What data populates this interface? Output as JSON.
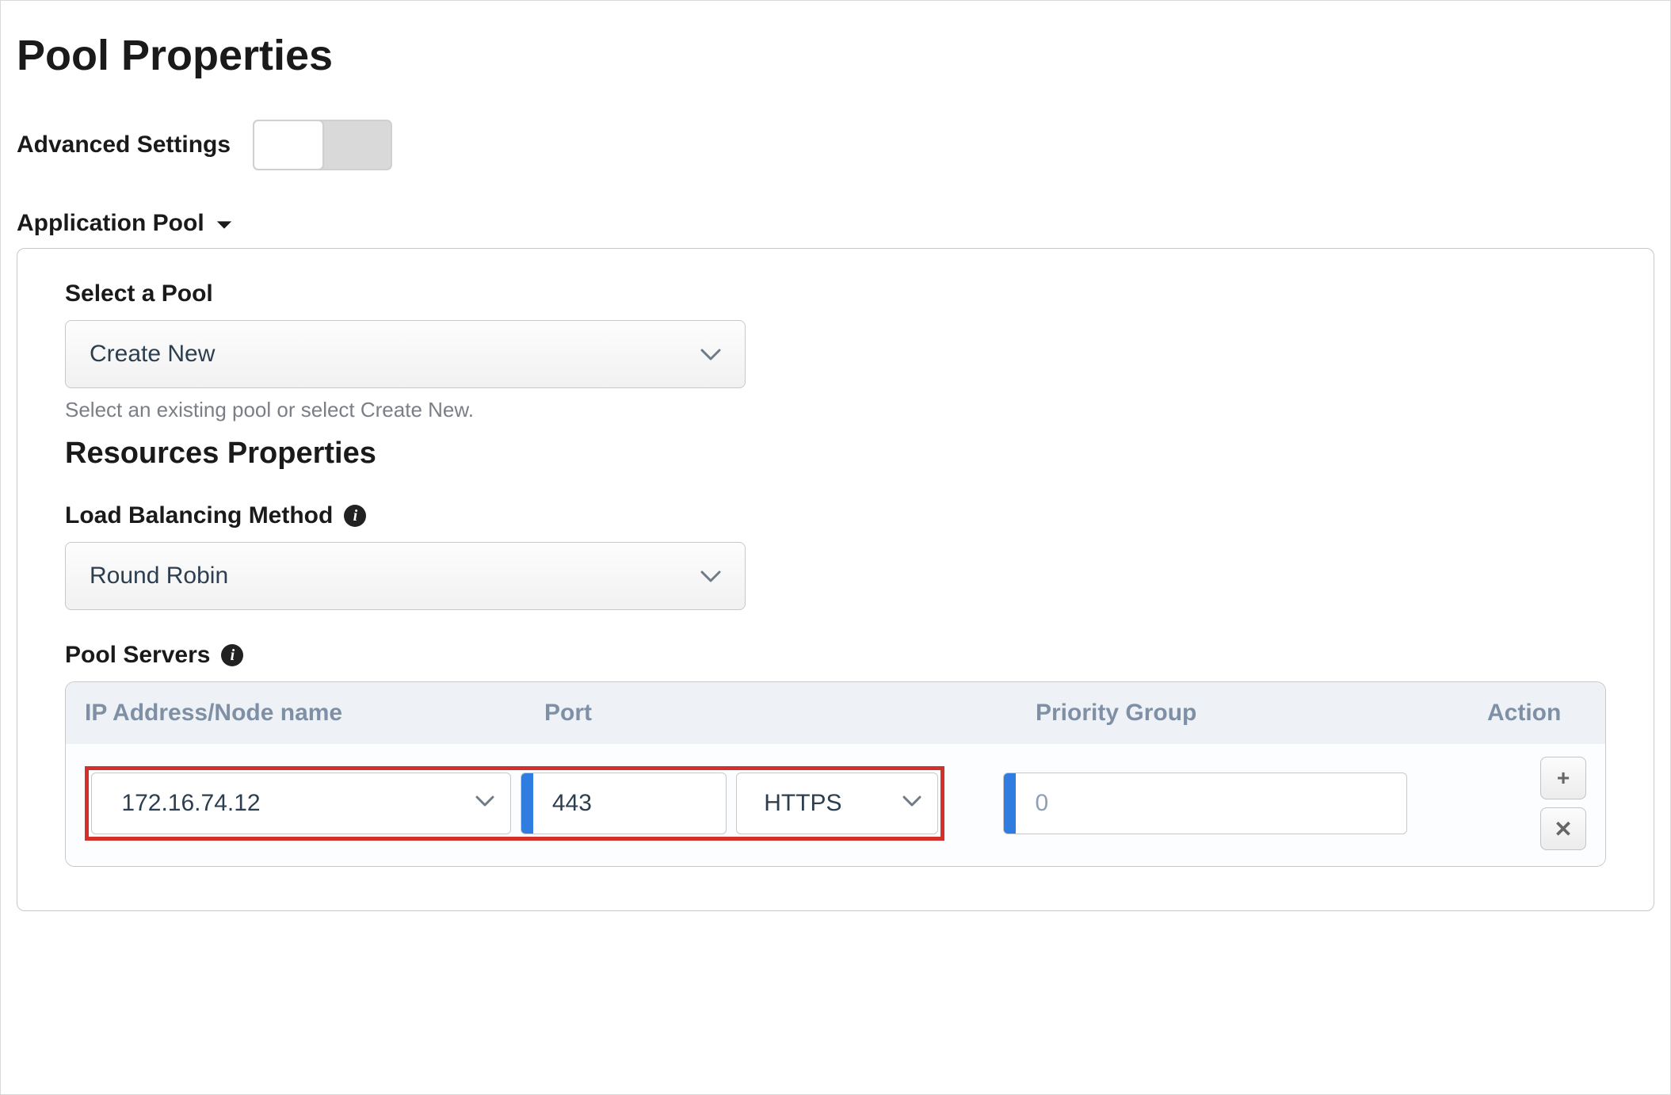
{
  "title": "Pool Properties",
  "advanced_settings": {
    "label": "Advanced Settings",
    "enabled": false
  },
  "application_pool": {
    "section_label": "Application Pool",
    "select_pool": {
      "label": "Select a Pool",
      "value": "Create New",
      "helper": "Select an existing pool or select Create New."
    },
    "resources_heading": "Resources Properties",
    "load_balancing": {
      "label": "Load Balancing Method",
      "value": "Round Robin"
    },
    "pool_servers": {
      "label": "Pool Servers",
      "columns": {
        "ip": "IP Address/Node name",
        "port": "Port",
        "priority": "Priority Group",
        "action": "Action"
      },
      "rows": [
        {
          "ip": "172.16.74.12",
          "port": "443",
          "protocol": "HTTPS",
          "priority": "0"
        }
      ]
    }
  },
  "icons": {
    "plus": "+",
    "close": "✕"
  }
}
